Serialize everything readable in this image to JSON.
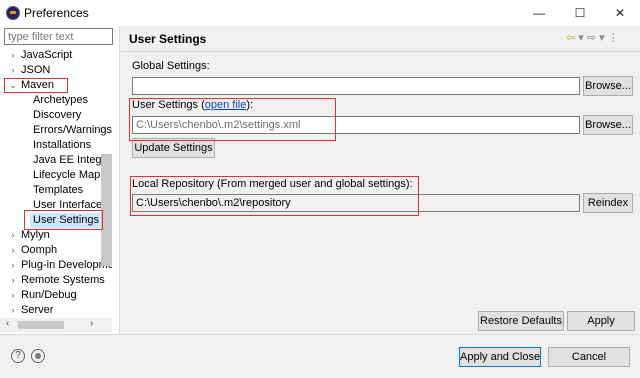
{
  "window": {
    "title": "Preferences",
    "minimize": "—",
    "maximize": "☐",
    "close": "✕"
  },
  "filter": {
    "placeholder": "type filter text"
  },
  "tree": {
    "items": [
      {
        "label": "JavaScript",
        "arrow": "›"
      },
      {
        "label": "JSON",
        "arrow": "›"
      },
      {
        "label": "Maven",
        "arrow": "⌄"
      },
      {
        "label": "Archetypes"
      },
      {
        "label": "Discovery"
      },
      {
        "label": "Errors/Warnings"
      },
      {
        "label": "Installations"
      },
      {
        "label": "Java EE Integration"
      },
      {
        "label": "Lifecycle Mappings"
      },
      {
        "label": "Templates"
      },
      {
        "label": "User Interface"
      },
      {
        "label": "User Settings"
      },
      {
        "label": "Mylyn",
        "arrow": "›"
      },
      {
        "label": "Oomph",
        "arrow": "›"
      },
      {
        "label": "Plug-in Development",
        "arrow": "›"
      },
      {
        "label": "Remote Systems",
        "arrow": "›"
      },
      {
        "label": "Run/Debug",
        "arrow": "›"
      },
      {
        "label": "Server",
        "arrow": "›"
      }
    ],
    "selected": "User Settings",
    "hscroll_left": "‹",
    "hscroll_right": "›"
  },
  "page": {
    "title": "User Settings",
    "nav_back": "⇦",
    "nav_back_menu": "▾",
    "nav_forward": "⇨",
    "nav_forward_menu": "▾",
    "view_menu": "⋮",
    "global_settings_label": "Global Settings:",
    "global_settings_value": "",
    "browse_label": "Browse...",
    "user_settings_label": "User Settings (",
    "open_file_link": "open file",
    "user_settings_label_end": "):",
    "user_settings_value": "C:\\Users\\chenbo\\.m2\\settings.xml",
    "update_settings_label": "Update Settings",
    "local_repo_label": "Local Repository (From merged user and global settings):",
    "local_repo_value": "C:\\Users\\chenbo\\.m2\\repository",
    "reindex_label": "Reindex",
    "restore_defaults_label": "Restore Defaults",
    "apply_label": "Apply"
  },
  "bottom": {
    "help_icon_glyph": "?",
    "apply_close_label": "Apply and Close",
    "cancel_label": "Cancel"
  },
  "colors": {
    "highlight": "#e03030",
    "selection": "#cce8ff",
    "link": "#0645ad"
  }
}
